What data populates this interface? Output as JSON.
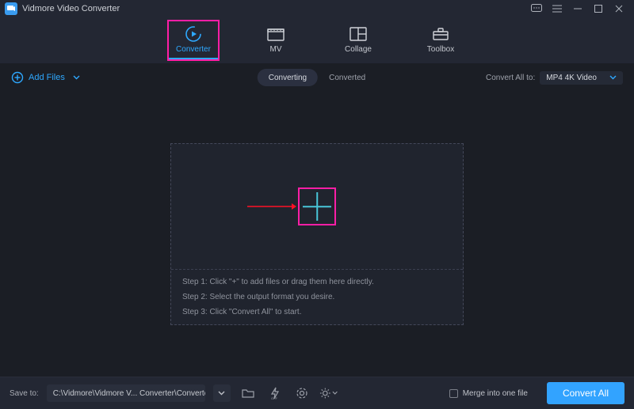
{
  "app": {
    "title": "Vidmore Video Converter"
  },
  "nav": {
    "converter": "Converter",
    "mv": "MV",
    "collage": "Collage",
    "toolbox": "Toolbox"
  },
  "actions": {
    "add_files": "Add Files",
    "converting_tab": "Converting",
    "converted_tab": "Converted",
    "convert_all_to_label": "Convert All to:",
    "format_selected": "MP4 4K Video"
  },
  "steps": {
    "s1": "Step 1: Click \"+\" to add files or drag them here directly.",
    "s2": "Step 2: Select the output format you desire.",
    "s3": "Step 3: Click \"Convert All\" to start."
  },
  "bottom": {
    "save_to_label": "Save to:",
    "path": "C:\\Vidmore\\Vidmore V... Converter\\Converted",
    "merge_label": "Merge into one file",
    "convert_all": "Convert All"
  }
}
